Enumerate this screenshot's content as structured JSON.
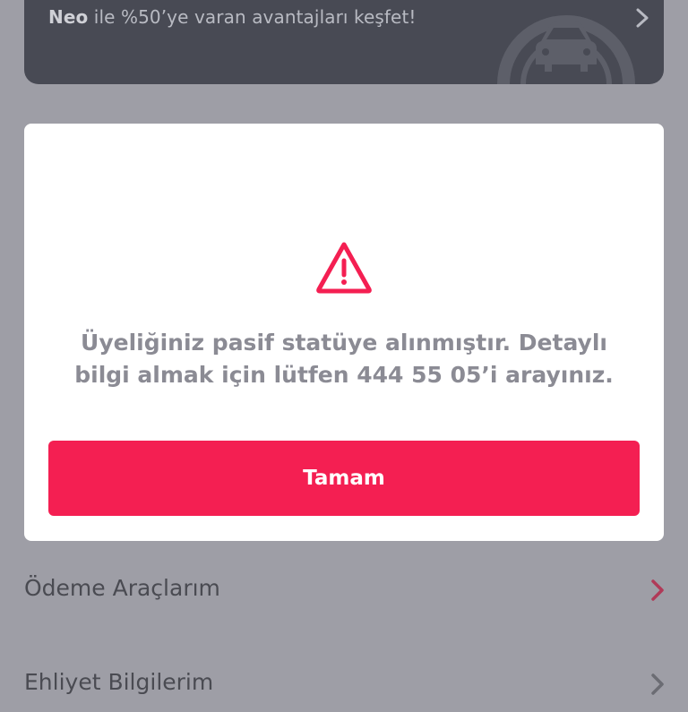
{
  "promo": {
    "brand": "Neo",
    "text": " ile %50’ye varan avantajları keşfet!",
    "icon": "car-gauge-icon"
  },
  "dialog": {
    "icon": "warning-triangle-icon",
    "message": "Üyeliğiniz pasif statüye alınmıştır. Detaylı bilgi almak için lütfen 444 55 05’i arayınız.",
    "button_label": "Tamam",
    "accent_color": "#f41f52"
  },
  "menu": {
    "items": [
      {
        "label": "Ödeme Araçlarım",
        "chevron_color": "#b03a58"
      },
      {
        "label": "Ehliyet Bilgilerim",
        "chevron_color": "#6b6c73"
      }
    ]
  },
  "colors": {
    "overlay_background": "#9e9ea6",
    "banner_background": "#484a54",
    "dialog_background": "#ffffff",
    "message_text": "#8b8b94"
  }
}
